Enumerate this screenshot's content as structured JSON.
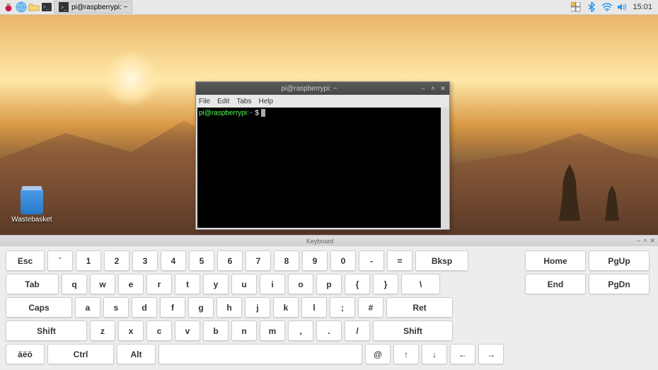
{
  "taskbar": {
    "task_label": "pi@raspberrypi: ~",
    "time": "15:01"
  },
  "desktop": {
    "wastebasket_label": "Wastebasket"
  },
  "terminal": {
    "title": "pi@raspberrypi: ~",
    "menu": {
      "file": "File",
      "edit": "Edit",
      "tabs": "Tabs",
      "help": "Help"
    },
    "prompt_user": "pi@raspberrypi",
    "prompt_sep": ":",
    "prompt_path": "~",
    "prompt_dollar": " $ "
  },
  "keyboard": {
    "title": "Keyboard",
    "rows": [
      [
        "Esc",
        "`",
        "1",
        "2",
        "3",
        "4",
        "5",
        "6",
        "7",
        "8",
        "9",
        "0",
        "-",
        "=",
        "Bksp"
      ],
      [
        "Tab",
        "q",
        "w",
        "e",
        "r",
        "t",
        "y",
        "u",
        "i",
        "o",
        "p",
        "{",
        "}",
        "\\"
      ],
      [
        "Caps",
        "a",
        "s",
        "d",
        "f",
        "g",
        "h",
        "j",
        "k",
        "l",
        ";",
        "#",
        "Ret"
      ],
      [
        "Shift",
        "z",
        "x",
        "c",
        "v",
        "b",
        "n",
        "m",
        ",",
        ".",
        "/",
        "Shift"
      ],
      [
        "äëö",
        "Ctrl",
        "Alt",
        "",
        "@",
        "↑",
        "↓",
        "←",
        "→"
      ]
    ],
    "side": [
      "Home",
      "PgUp",
      "End",
      "PgDn"
    ]
  }
}
